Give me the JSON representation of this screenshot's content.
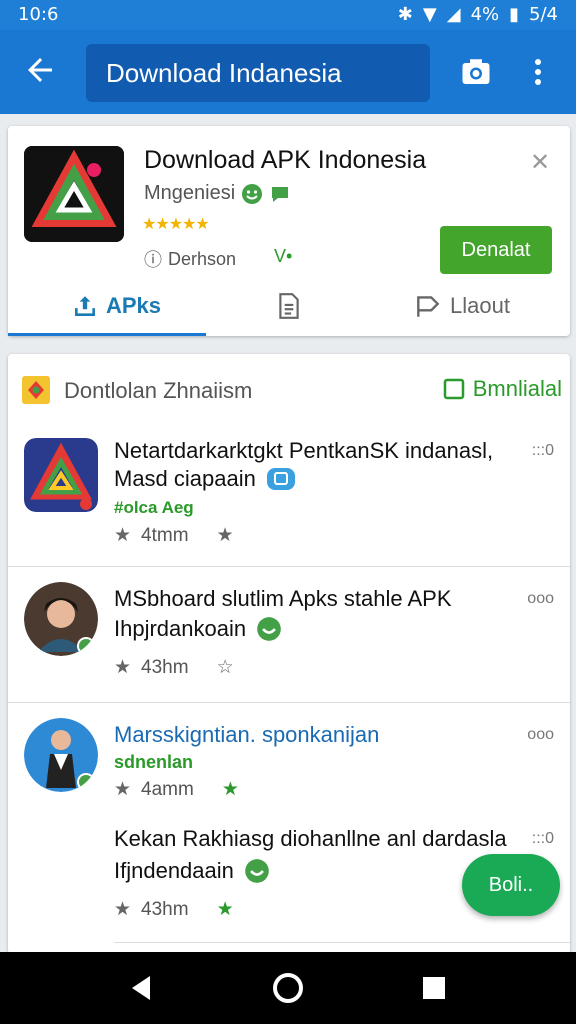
{
  "status": {
    "time": "10:6",
    "battery": "4%",
    "signal": "5/4"
  },
  "appbar": {
    "search_value": "Download Indanesia"
  },
  "app_card": {
    "title": "Download APK Indonesia",
    "developer": "Mngeniesi",
    "meta_left": "Derhson",
    "meta_right": "V•",
    "install_label": "Denalat",
    "tabs": [
      {
        "label": "APks"
      },
      {
        "label": ""
      },
      {
        "label": "Llaout"
      }
    ]
  },
  "section": {
    "title": "Dontlolan Zhnaiism",
    "right_label": "Bmnlialal",
    "items": [
      {
        "title": "Netartdarkarktgkt PentkanSK indanasl,",
        "subtitle": "Masd ciapaain",
        "tag": "#olca Aeg",
        "stat": "4tmm",
        "more": ":::0"
      },
      {
        "title": "MSbhoard slutlim Apks stahle APK",
        "subtitle": "Ihpjrdankoain",
        "stat": "43hm",
        "more": "ooo"
      },
      {
        "title": "Marsskigntian. sponkanijan",
        "subtitle": "sdnenlan",
        "stat": "4amm",
        "more": "ooo"
      },
      {
        "title": "Kekan Rakhiasg diohanllne anl dardasla",
        "subtitle": "Ifjndendaain",
        "stat": "43hm",
        "more": ":::0"
      }
    ]
  },
  "fab": {
    "label": "Boli.."
  },
  "colors": {
    "primary": "#1a77d2",
    "accent_green": "#44a52d",
    "fab": "#1aaa55"
  }
}
